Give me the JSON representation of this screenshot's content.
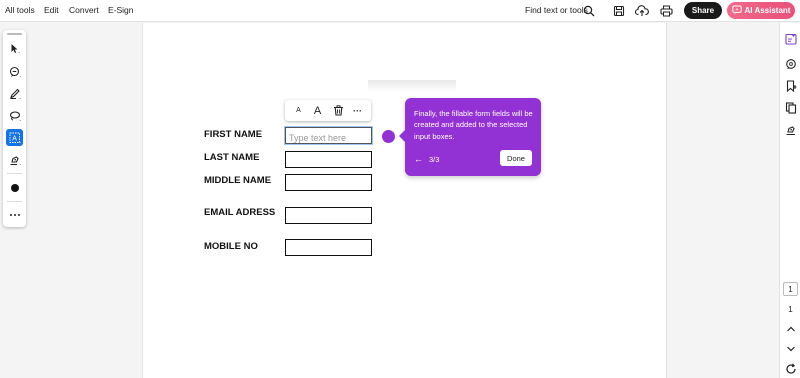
{
  "menu": {
    "items": [
      {
        "label": "All tools"
      },
      {
        "label": "Edit"
      },
      {
        "label": "Convert"
      },
      {
        "label": "E-Sign"
      }
    ]
  },
  "toolbar": {
    "find_label": "Find text or tools",
    "share_label": "Share",
    "ai_label": "AI Assistant",
    "icons": [
      "search-icon",
      "save-icon",
      "upload-cloud-icon",
      "print-icon"
    ]
  },
  "left_tools": {
    "icons": [
      "select-cursor-icon",
      "comment-icon",
      "draw-pen-icon",
      "lasso-icon",
      "text-field-icon",
      "signature-pen-icon",
      "color-dot-icon",
      "more-icon"
    ],
    "active": "text-field-icon",
    "accent": "#1473e6"
  },
  "form": {
    "fields": [
      {
        "label": "FIRST NAME",
        "placeholder": "Type text here"
      },
      {
        "label": "LAST NAME"
      },
      {
        "label": "MIDDLE NAME"
      },
      {
        "label": "EMAIL ADRESS"
      },
      {
        "label": "MOBILE NO"
      }
    ]
  },
  "mini_toolbar": {
    "small_a": "A",
    "large_a": "A",
    "more": "···"
  },
  "coachmark": {
    "text": "Finally, the fillable form fields will be created and added to the selected input boxes.",
    "back": "←",
    "step": "3/3",
    "done_label": "Done",
    "color": "#9332d4"
  },
  "right_rail": {
    "icons": [
      "form-fill-icon",
      "comment-bubble-icon",
      "bookmark-icon",
      "copy-pages-icon",
      "sign-icon",
      "chevron-up-icon",
      "chevron-down-icon",
      "refresh-icon"
    ],
    "page_current": "1",
    "page_total": "1"
  }
}
